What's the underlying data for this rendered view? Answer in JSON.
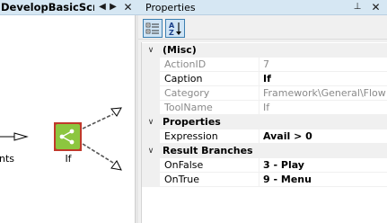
{
  "designer": {
    "tab_title": "DevelopBasicScript",
    "prev_icon": "triangle-left-icon",
    "next_icon": "triangle-right-icon",
    "close_icon": "close-icon",
    "fragment_label": "nts",
    "node": {
      "label": "If",
      "icon": "share-branch-icon",
      "fill_color": "#8cc63f",
      "border_color": "#c0392b"
    }
  },
  "properties": {
    "title": "Properties",
    "pin_icon": "pin-icon",
    "close_icon": "close-icon",
    "toolbar": {
      "categorized_icon": "categorized-view-icon",
      "alpha_icon": "sort-az-icon"
    },
    "categories": [
      {
        "label": "(Misc)"
      },
      {
        "label": "Properties"
      },
      {
        "label": "Result Branches"
      }
    ],
    "rows": [
      {
        "name": "ActionID",
        "value": "7"
      },
      {
        "name": "Caption",
        "value": "If"
      },
      {
        "name": "Category",
        "value": "Framework\\General\\Flow"
      },
      {
        "name": "ToolName",
        "value": "If"
      },
      {
        "name": "Expression",
        "value": "Avail > 0"
      },
      {
        "name": "OnFalse",
        "value": "3 - Play"
      },
      {
        "name": "OnTrue",
        "value": "9 - Menu"
      }
    ]
  },
  "colors": {
    "tab_bar": "#d6e7f3",
    "toolbar_selected": "#cfe4f5",
    "toolbar_border": "#3c7fb1",
    "readonly_text": "#8a8a8a"
  }
}
